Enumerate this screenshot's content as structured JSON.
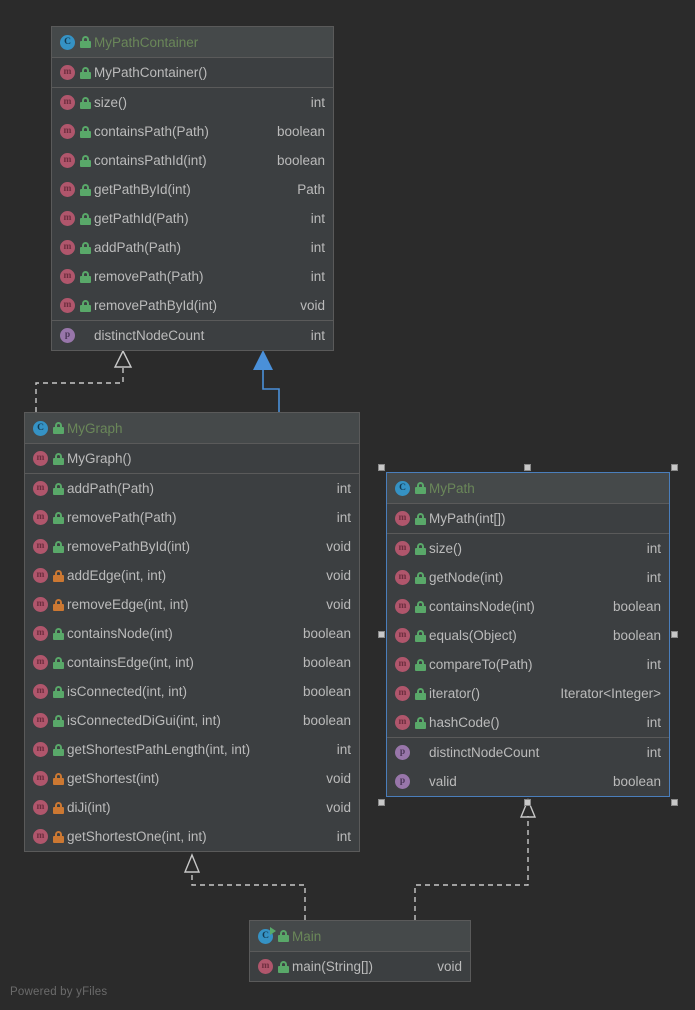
{
  "watermark": "Powered by yFiles",
  "colors": {
    "background": "#2b2b2b",
    "node_body": "#3c3f41",
    "node_header": "#45494a",
    "border": "#5a5a5a",
    "class_name": "#6a8759",
    "member_text": "#bbbbbb",
    "selection": "#4a7ebb",
    "public_lock": "#59a869",
    "protected_lock": "#cc7832",
    "class_icon": "#3592c4",
    "method_icon": "#b0566c",
    "property_icon": "#9876aa"
  },
  "classes": [
    {
      "id": "MyPathContainer",
      "name": "MyPathContainer",
      "icon": "class-icon",
      "visibility": "public",
      "selected": false,
      "constructors": [
        {
          "icon": "method-icon",
          "visibility": "public",
          "name": "MyPathContainer()",
          "return_type": ""
        }
      ],
      "methods": [
        {
          "icon": "method-icon",
          "visibility": "public",
          "name": "size()",
          "return_type": "int"
        },
        {
          "icon": "method-icon",
          "visibility": "public",
          "name": "containsPath(Path)",
          "return_type": "boolean"
        },
        {
          "icon": "method-icon",
          "visibility": "public",
          "name": "containsPathId(int)",
          "return_type": "boolean"
        },
        {
          "icon": "method-icon",
          "visibility": "public",
          "name": "getPathById(int)",
          "return_type": "Path"
        },
        {
          "icon": "method-icon",
          "visibility": "public",
          "name": "getPathId(Path)",
          "return_type": "int"
        },
        {
          "icon": "method-icon",
          "visibility": "public",
          "name": "addPath(Path)",
          "return_type": "int"
        },
        {
          "icon": "method-icon",
          "visibility": "public",
          "name": "removePath(Path)",
          "return_type": "int"
        },
        {
          "icon": "method-icon",
          "visibility": "public",
          "name": "removePathById(int)",
          "return_type": "void"
        }
      ],
      "properties": [
        {
          "icon": "property-icon",
          "visibility": "none",
          "name": "distinctNodeCount",
          "return_type": "int"
        }
      ]
    },
    {
      "id": "MyGraph",
      "name": "MyGraph",
      "icon": "class-icon",
      "visibility": "public",
      "selected": false,
      "constructors": [
        {
          "icon": "method-icon",
          "visibility": "public",
          "name": "MyGraph()",
          "return_type": ""
        }
      ],
      "methods": [
        {
          "icon": "method-icon",
          "visibility": "public",
          "name": "addPath(Path)",
          "return_type": "int"
        },
        {
          "icon": "method-icon",
          "visibility": "public",
          "name": "removePath(Path)",
          "return_type": "int"
        },
        {
          "icon": "method-icon",
          "visibility": "public",
          "name": "removePathById(int)",
          "return_type": "void"
        },
        {
          "icon": "method-icon",
          "visibility": "protected",
          "name": "addEdge(int, int)",
          "return_type": "void"
        },
        {
          "icon": "method-icon",
          "visibility": "protected",
          "name": "removeEdge(int, int)",
          "return_type": "void"
        },
        {
          "icon": "method-icon",
          "visibility": "public",
          "name": "containsNode(int)",
          "return_type": "boolean"
        },
        {
          "icon": "method-icon",
          "visibility": "public",
          "name": "containsEdge(int, int)",
          "return_type": "boolean"
        },
        {
          "icon": "method-icon",
          "visibility": "public",
          "name": "isConnected(int, int)",
          "return_type": "boolean"
        },
        {
          "icon": "method-icon",
          "visibility": "public",
          "name": "isConnectedDiGui(int, int)",
          "return_type": "boolean"
        },
        {
          "icon": "method-icon",
          "visibility": "public",
          "name": "getShortestPathLength(int, int)",
          "return_type": "int"
        },
        {
          "icon": "method-icon",
          "visibility": "protected",
          "name": "getShortest(int)",
          "return_type": "void"
        },
        {
          "icon": "method-icon",
          "visibility": "protected",
          "name": "diJi(int)",
          "return_type": "void"
        },
        {
          "icon": "method-icon",
          "visibility": "protected",
          "name": "getShortestOne(int, int)",
          "return_type": "int"
        }
      ],
      "properties": []
    },
    {
      "id": "MyPath",
      "name": "MyPath",
      "icon": "class-icon",
      "visibility": "public",
      "selected": true,
      "constructors": [
        {
          "icon": "method-icon",
          "visibility": "public",
          "name": "MyPath(int[])",
          "return_type": ""
        }
      ],
      "methods": [
        {
          "icon": "method-icon",
          "visibility": "public",
          "name": "size()",
          "return_type": "int"
        },
        {
          "icon": "method-icon",
          "visibility": "public",
          "name": "getNode(int)",
          "return_type": "int"
        },
        {
          "icon": "method-icon",
          "visibility": "public",
          "name": "containsNode(int)",
          "return_type": "boolean"
        },
        {
          "icon": "method-icon",
          "visibility": "public",
          "name": "equals(Object)",
          "return_type": "boolean"
        },
        {
          "icon": "method-icon",
          "visibility": "public",
          "name": "compareTo(Path)",
          "return_type": "int"
        },
        {
          "icon": "method-icon",
          "visibility": "public",
          "name": "iterator()",
          "return_type": "Iterator<Integer>"
        },
        {
          "icon": "method-icon",
          "visibility": "public",
          "name": "hashCode()",
          "return_type": "int"
        }
      ],
      "properties": [
        {
          "icon": "property-icon",
          "visibility": "none",
          "name": "distinctNodeCount",
          "return_type": "int"
        },
        {
          "icon": "property-icon",
          "visibility": "none",
          "name": "valid",
          "return_type": "boolean"
        }
      ]
    },
    {
      "id": "Main",
      "name": "Main",
      "icon": "runnable-class-icon",
      "visibility": "public",
      "selected": false,
      "constructors": [],
      "methods": [
        {
          "icon": "method-icon",
          "visibility": "public",
          "name": "main(String[])",
          "return_type": "void"
        }
      ],
      "properties": []
    }
  ],
  "edges": [
    {
      "from": "MyGraph",
      "to": "MyPathContainer",
      "style": "dashed",
      "arrow": "hollow-triangle",
      "color": "#c8c8c8",
      "relation": "realization"
    },
    {
      "from": "MyPath",
      "to": "MyPathContainer",
      "style": "solid",
      "arrow": "filled-triangle",
      "color": "#4a90d9",
      "relation": "generalization-selected"
    },
    {
      "from": "Main",
      "to": "MyGraph",
      "style": "dashed",
      "arrow": "hollow-triangle",
      "color": "#c8c8c8",
      "relation": "dependency"
    },
    {
      "from": "Main",
      "to": "MyPath",
      "style": "dashed",
      "arrow": "hollow-triangle",
      "color": "#c8c8c8",
      "relation": "dependency"
    }
  ]
}
